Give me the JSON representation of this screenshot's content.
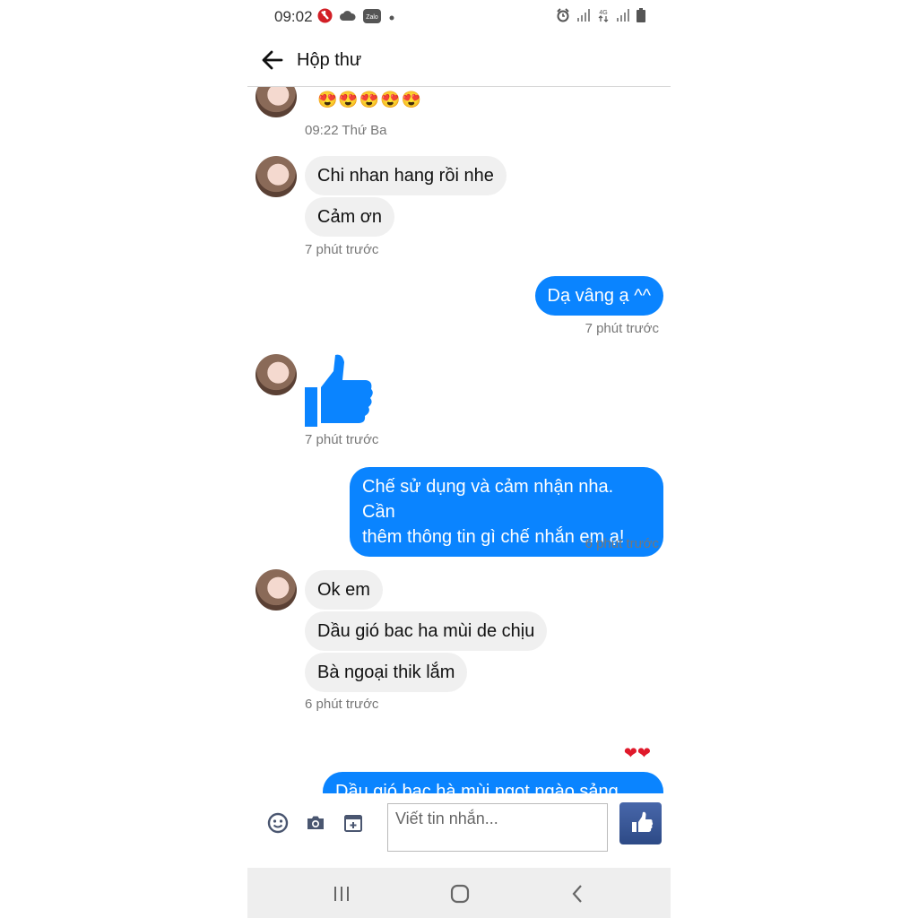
{
  "status_bar": {
    "time": "09:02",
    "zalo_label": "Zalo",
    "network_label": "4G"
  },
  "header": {
    "title": "Hộp thư"
  },
  "messages": {
    "m0": {
      "emoji": "😍😍😍😍😍"
    },
    "m0_time": "09:22 Thứ Ba",
    "m1": "Chi nhan hang rồi nhe",
    "m2": "Cảm ơn",
    "m2_time": "7 phút trước",
    "m3": "Dạ vâng ạ ^^",
    "m3_time": "7 phút trước",
    "m4_time": "7 phút trước",
    "m5_line1": "Chế sử dụng và cảm nhận nha. Cần",
    "m5_line2": "thêm thông tin gì chế nhắn em ạ!",
    "m5_time": "6 phút trước",
    "m6": "Ok em",
    "m7": "Dầu gió bac ha mùi de chịu",
    "m8": "Bà ngoại thik lắm",
    "m8_time": "6 phút trước",
    "m9_reaction": "❤❤",
    "m9_partial": "Dầu gió bạc hà mùi ngọt ngào sảng"
  },
  "composer": {
    "placeholder": "Viết tin nhắn..."
  },
  "colors": {
    "outgoing_bubble": "#0a84ff",
    "incoming_bubble": "#f0f0f0",
    "like_button": "#3b5998"
  },
  "icons": {
    "back": "arrow-left-icon",
    "emoji": "smiley-icon",
    "camera": "camera-icon",
    "attach": "calendar-plus-icon",
    "like": "thumbs-up-icon",
    "nav_recents": "recents-icon",
    "nav_home": "home-icon",
    "nav_back": "chevron-left-icon"
  }
}
